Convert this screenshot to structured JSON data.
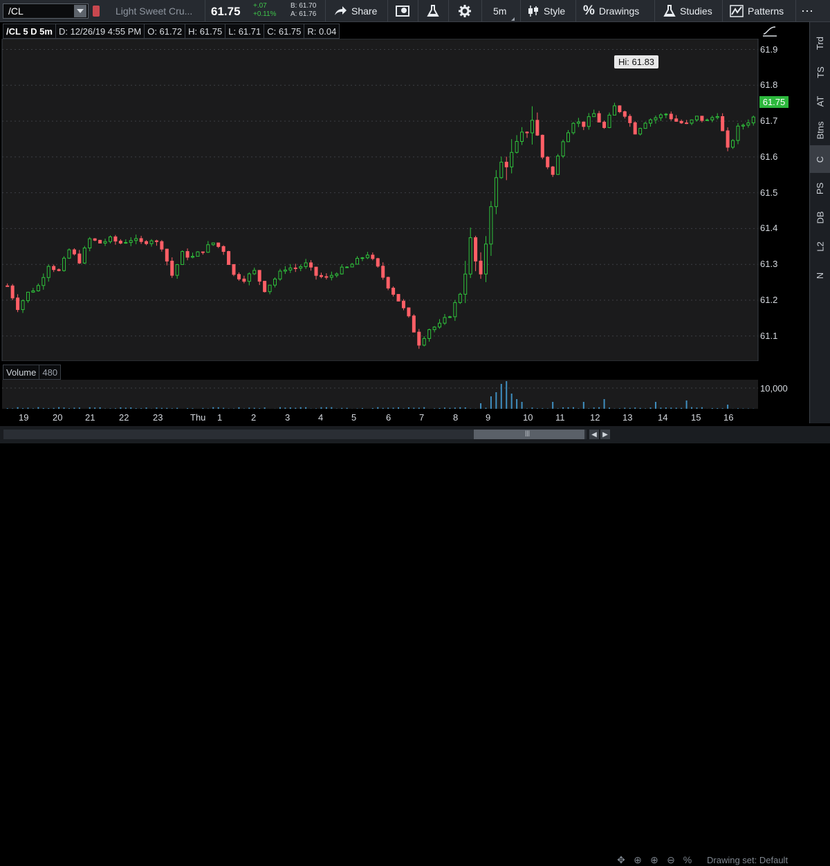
{
  "toolbar": {
    "symbol": "/CL",
    "description": "Light Sweet Cru...",
    "last_price": "61.75",
    "change": "+.07",
    "change_pct": "+0.11%",
    "bid": "B: 61.70",
    "ask": "A: 61.76",
    "share_label": "Share",
    "timeframe": "5m",
    "style_label": "Style",
    "drawings_label": "Drawings",
    "studies_label": "Studies",
    "patterns_label": "Patterns"
  },
  "infobar": {
    "title": "/CL 5 D 5m",
    "date": "D: 12/26/19 4:55 PM",
    "open": "O: 61.72",
    "high": "H: 61.75",
    "low": "L: 61.71",
    "close": "C: 61.75",
    "range": "R: 0.04"
  },
  "right_tabs": [
    "Trd",
    "TS",
    "AT",
    "Btns",
    "C",
    "PS",
    "DB",
    "L2",
    "N"
  ],
  "volume_panel": {
    "label": "Volume",
    "value": "480",
    "axis_label": "10,000"
  },
  "chart_data": {
    "type": "candlestick",
    "y_ticks": [
      "61.9",
      "61.8",
      "61.7",
      "61.6",
      "61.5",
      "61.4",
      "61.3",
      "61.2",
      "61.1"
    ],
    "ylim": [
      61.03,
      61.93
    ],
    "x_ticks": [
      "19",
      "20",
      "21",
      "22",
      "23",
      "Thu",
      "1",
      "2",
      "3",
      "4",
      "5",
      "6",
      "7",
      "8",
      "9",
      "10",
      "11",
      "12",
      "13",
      "14",
      "15",
      "16"
    ],
    "high_label": "Hi: 61.83",
    "high_value": 61.83,
    "last_value": 61.75,
    "last_label": "61.75",
    "up_color": "#2fc33c",
    "down_color": "#ff5f66",
    "price_path": [
      [
        0,
        61.24
      ],
      [
        2,
        61.18
      ],
      [
        4,
        61.22
      ],
      [
        6,
        61.24
      ],
      [
        8,
        61.3
      ],
      [
        10,
        61.28
      ],
      [
        12,
        61.34
      ],
      [
        14,
        61.31
      ],
      [
        16,
        61.37
      ],
      [
        18,
        61.36
      ],
      [
        20,
        61.37
      ],
      [
        22,
        61.36
      ],
      [
        24,
        61.37
      ],
      [
        26,
        61.36
      ],
      [
        28,
        61.37
      ],
      [
        30,
        61.35
      ],
      [
        32,
        61.27
      ],
      [
        34,
        61.33
      ],
      [
        36,
        61.32
      ],
      [
        38,
        61.34
      ],
      [
        40,
        61.36
      ],
      [
        42,
        61.34
      ],
      [
        44,
        61.27
      ],
      [
        46,
        61.26
      ],
      [
        48,
        61.28
      ],
      [
        50,
        61.23
      ],
      [
        52,
        61.26
      ],
      [
        54,
        61.29
      ],
      [
        56,
        61.29
      ],
      [
        58,
        61.3
      ],
      [
        60,
        61.27
      ],
      [
        62,
        61.26
      ],
      [
        64,
        61.28
      ],
      [
        66,
        61.29
      ],
      [
        68,
        61.31
      ],
      [
        70,
        61.33
      ],
      [
        72,
        61.29
      ],
      [
        74,
        61.24
      ],
      [
        76,
        61.2
      ],
      [
        78,
        61.15
      ],
      [
        80,
        61.08
      ],
      [
        82,
        61.12
      ],
      [
        84,
        61.13
      ],
      [
        86,
        61.16
      ],
      [
        88,
        61.22
      ],
      [
        90,
        61.36
      ],
      [
        92,
        61.25
      ],
      [
        94,
        61.48
      ],
      [
        96,
        61.58
      ],
      [
        98,
        61.6
      ],
      [
        100,
        61.65
      ],
      [
        102,
        61.71
      ],
      [
        104,
        61.6
      ],
      [
        106,
        61.55
      ],
      [
        108,
        61.65
      ],
      [
        110,
        61.7
      ],
      [
        112,
        61.69
      ],
      [
        114,
        61.72
      ],
      [
        116,
        61.68
      ],
      [
        118,
        61.74
      ],
      [
        120,
        61.72
      ],
      [
        122,
        61.67
      ],
      [
        124,
        61.7
      ],
      [
        126,
        61.71
      ],
      [
        128,
        61.72
      ],
      [
        130,
        61.7
      ],
      [
        132,
        61.69
      ],
      [
        134,
        61.71
      ],
      [
        136,
        61.7
      ],
      [
        138,
        61.72
      ],
      [
        140,
        61.62
      ],
      [
        142,
        61.68
      ],
      [
        144,
        61.7
      ],
      [
        146,
        61.72
      ]
    ],
    "volume_spikes": [
      [
        92,
        0.2
      ],
      [
        94,
        0.45
      ],
      [
        95,
        0.6
      ],
      [
        96,
        0.9
      ],
      [
        97,
        1.0
      ],
      [
        98,
        0.55
      ],
      [
        99,
        0.35
      ],
      [
        100,
        0.25
      ],
      [
        106,
        0.25
      ],
      [
        112,
        0.25
      ],
      [
        116,
        0.35
      ],
      [
        126,
        0.25
      ],
      [
        132,
        0.3
      ],
      [
        140,
        0.15
      ]
    ]
  },
  "scrollbar": {
    "drawing_set": "Drawing set: Default"
  }
}
